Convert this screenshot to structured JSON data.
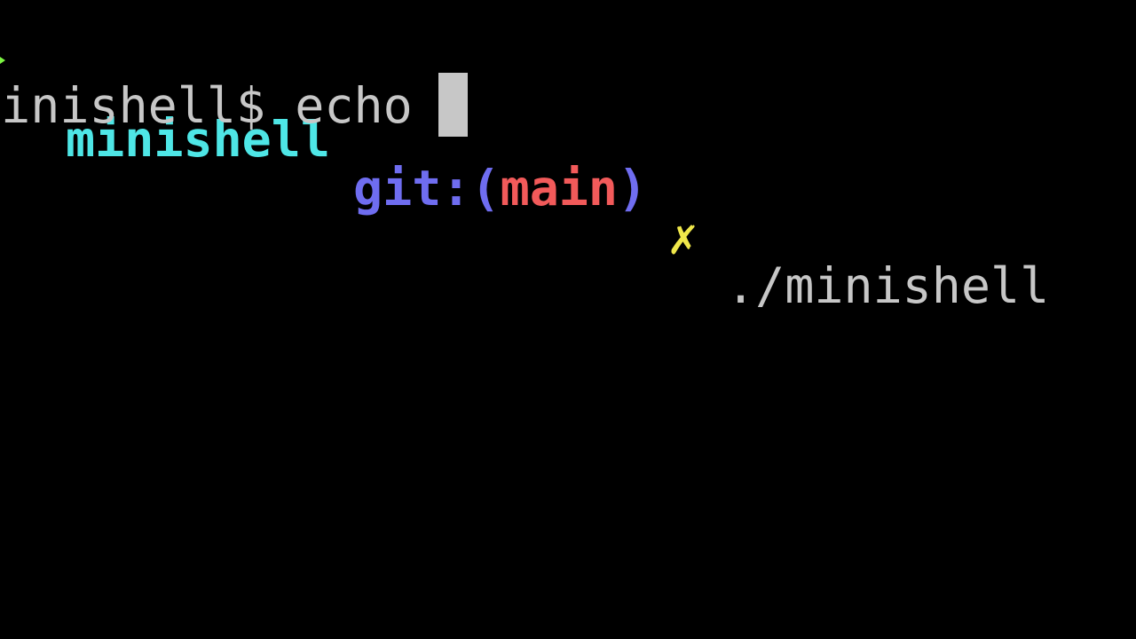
{
  "colors": {
    "background": "#000000",
    "arrow": "#7cf542",
    "directory": "#4ee6e6",
    "git_label": "#6f6df0",
    "branch": "#f25a5a",
    "dirty": "#f0e84a",
    "command": "#c7c7c7",
    "cursor": "#c7c7c7"
  },
  "prompt": {
    "arrow_icon": "arrow-right-icon",
    "directory": "minishell",
    "git_prefix": "git:(",
    "branch": "main",
    "git_suffix": ")",
    "dirty_marker": "✗",
    "command": "./minishell"
  },
  "shell_line": {
    "prompt": "minishell$",
    "input": "echo "
  }
}
